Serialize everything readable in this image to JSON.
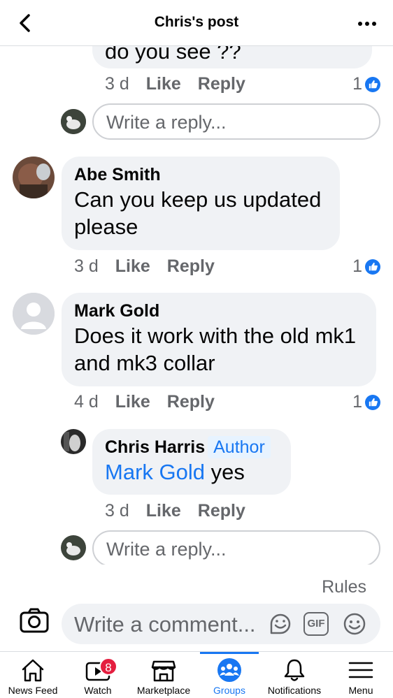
{
  "header": {
    "title": "Chris's post"
  },
  "comments": [
    {
      "truncated_text": "do you see ??",
      "time": "3 d",
      "like": "Like",
      "reply": "Reply",
      "likes": "1",
      "reply_placeholder": "Write a reply..."
    },
    {
      "author": "Abe Smith",
      "text_line1": "Can you keep us updated",
      "text_line2": "please",
      "time": "3 d",
      "like": "Like",
      "reply": "Reply",
      "likes": "1"
    },
    {
      "author": "Mark Gold",
      "text_line1": "Does it work with the old mk1",
      "text_line2": "and mk3 collar",
      "time": "4 d",
      "like": "Like",
      "reply": "Reply",
      "likes": "1"
    },
    {
      "author": "Chris Harris",
      "badge": "Author",
      "mention": "Mark Gold",
      "text": " yes",
      "time": "3 d",
      "like": "Like",
      "reply": "Reply",
      "reply_placeholder": "Write a reply..."
    }
  ],
  "composer": {
    "rules": "Rules",
    "placeholder": "Write a comment...",
    "gif": "GIF"
  },
  "nav": [
    {
      "label": "News Feed",
      "icon": "home-icon"
    },
    {
      "label": "Watch",
      "icon": "watch-icon",
      "badge": "8"
    },
    {
      "label": "Marketplace",
      "icon": "marketplace-icon"
    },
    {
      "label": "Groups",
      "icon": "groups-icon",
      "active": true
    },
    {
      "label": "Notifications",
      "icon": "bell-icon"
    },
    {
      "label": "Menu",
      "icon": "menu-icon"
    }
  ],
  "colors": {
    "accent": "#1877f2",
    "bubble": "#f0f2f5",
    "badge": "#e41e3f",
    "muted": "#65676b"
  }
}
